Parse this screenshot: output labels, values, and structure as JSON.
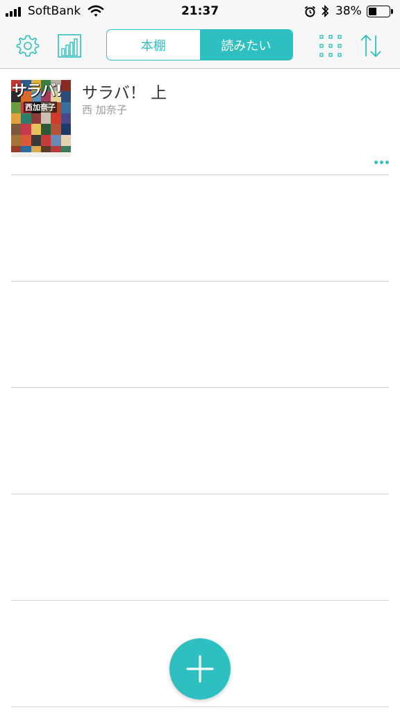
{
  "status_bar": {
    "carrier": "SoftBank",
    "time": "21:37",
    "battery_percent": "38%",
    "battery_level": 0.38,
    "icons": [
      "signal-bars-icon",
      "wifi-icon",
      "alarm-icon",
      "bluetooth-icon",
      "battery-icon"
    ]
  },
  "nav": {
    "icons": [
      "gear-icon",
      "bar-chart-icon",
      "grid-icon",
      "sort-arrows-icon"
    ],
    "tabs": [
      {
        "label": "本棚",
        "active": false
      },
      {
        "label": "読みたい",
        "active": true
      }
    ]
  },
  "books": [
    {
      "title": "サラバ！ 上",
      "author": "西 加奈子",
      "cover_text": "サラバ!",
      "cover_author": "西加奈子",
      "more_icon": "more-dots-icon"
    }
  ],
  "empty_rows": 4,
  "fab": {
    "icon": "plus-icon"
  },
  "colors": {
    "accent": "#2ec0c0",
    "bar_background": "#f7f7f7",
    "divider": "#cfcfcf",
    "title_text": "#333333",
    "secondary_text": "#999999"
  }
}
